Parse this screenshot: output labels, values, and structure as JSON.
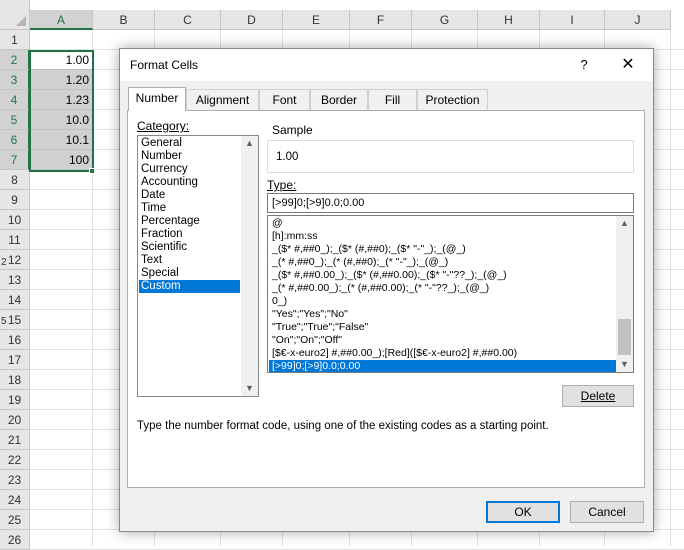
{
  "sheet": {
    "columns": [
      "A",
      "B",
      "C",
      "D",
      "E",
      "F",
      "G",
      "H",
      "I",
      "J"
    ],
    "rows": [
      "1",
      "2",
      "3",
      "4",
      "5",
      "6",
      "7",
      "8",
      "9",
      "10",
      "11",
      "12",
      "13",
      "14",
      "15",
      "16",
      "17",
      "18",
      "19",
      "20",
      "21",
      "22",
      "23",
      "24",
      "25",
      "26"
    ],
    "cells_a": [
      "1.00",
      "1.20",
      "1.23",
      "10.0",
      "10.1",
      "100"
    ],
    "left_edge_marks": [
      "2",
      "5"
    ]
  },
  "dialog": {
    "title": "Format Cells",
    "help": "?",
    "close": "✕",
    "tabs": [
      "Number",
      "Alignment",
      "Font",
      "Border",
      "Fill",
      "Protection"
    ],
    "category_label": "Category:",
    "categories": [
      "General",
      "Number",
      "Currency",
      "Accounting",
      "Date",
      "Time",
      "Percentage",
      "Fraction",
      "Scientific",
      "Text",
      "Special",
      "Custom"
    ],
    "selected_category": "Custom",
    "sample_label": "Sample",
    "sample_value": "1.00",
    "type_label": "Type:",
    "type_value": "[>99]0;[>9]0.0;0.00",
    "type_list": [
      "@",
      "[h]:mm:ss",
      "_($* #,##0_);_($* (#,##0);_($* \"-\"_);_(@_)",
      "_(* #,##0_);_(* (#,##0);_(* \"-\"_);_(@_)",
      "_($* #,##0.00_);_($* (#,##0.00);_($* \"-\"??_);_(@_)",
      "_(* #,##0.00_);_(* (#,##0.00);_(* \"-\"??_);_(@_)",
      "0_)",
      "\"Yes\";\"Yes\";\"No\"",
      "\"True\";\"True\";\"False\"",
      "\"On\";\"On\";\"Off\"",
      "[$€-x-euro2] #,##0.00_);[Red]([$€-x-euro2] #,##0.00)",
      "[>99]0;[>9]0.0;0.00"
    ],
    "delete_label": "Delete",
    "description": "Type the number format code, using one of the existing codes as a starting point.",
    "ok_label": "OK",
    "cancel_label": "Cancel"
  }
}
